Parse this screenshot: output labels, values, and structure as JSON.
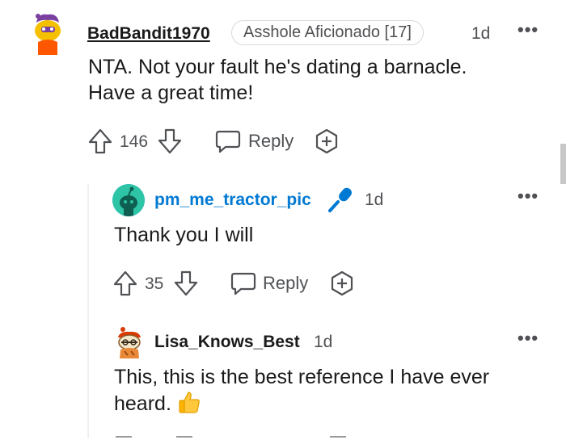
{
  "comments": [
    {
      "username": "BadBandit1970",
      "flair": "Asshole Aficionado [17]",
      "time": "1d",
      "body_lines": [
        "NTA. Not your fault he's dating a barnacle.",
        "Have a great time!"
      ],
      "votes": "146",
      "reply_label": "Reply"
    },
    {
      "username": "pm_me_tractor_pic",
      "time": "1d",
      "body_lines": [
        "Thank you I will"
      ],
      "votes": "35",
      "reply_label": "Reply",
      "accent": "#0079d3"
    },
    {
      "username": "Lisa_Knows_Best",
      "time": "1d",
      "body_lines": [
        "This, this is the best reference I have ever",
        "heard."
      ]
    }
  ],
  "icons": {
    "more": "more-options-icon",
    "upvote": "upvote-arrow-icon",
    "downvote": "downvote-arrow-icon",
    "reply": "speech-bubble-icon",
    "award": "award-plus-icon",
    "mic": "microphone-icon",
    "thumbs": "thumbs-up-emoji"
  },
  "colors": {
    "op_username": "#0079d3",
    "meta": "#4f5154",
    "text": "#1a1a1b"
  }
}
